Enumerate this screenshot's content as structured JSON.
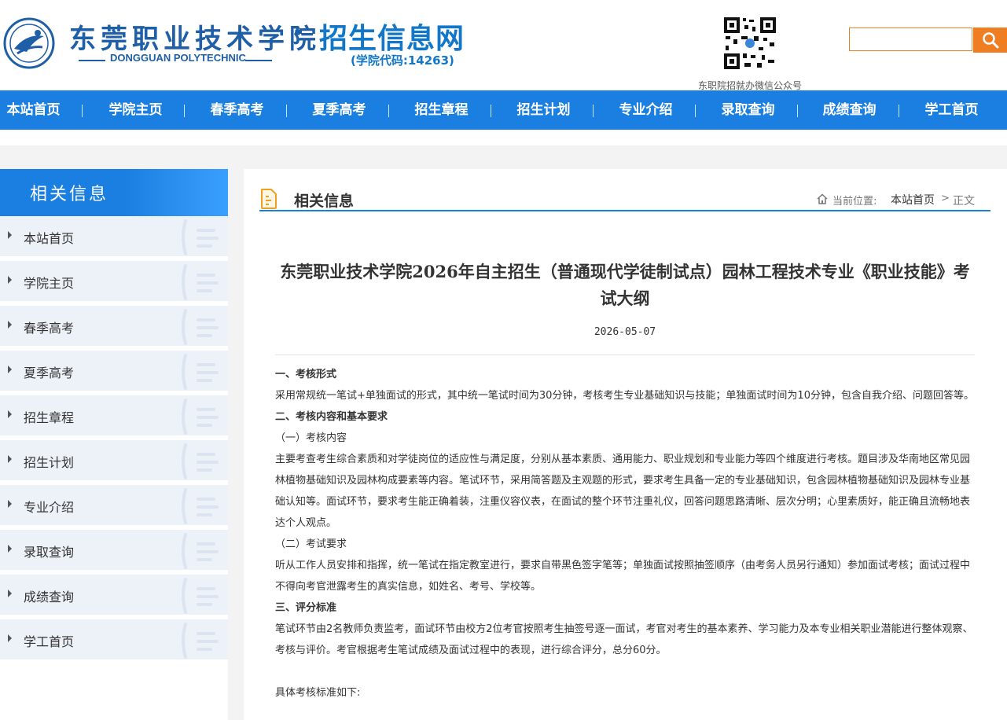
{
  "header": {
    "school_name_cn": "东莞职业技术学院",
    "school_name_en": "DONGGUAN POLYTECHNIC",
    "dot": "·",
    "site_title": "招生信息网",
    "school_code": "(学院代码:14263)",
    "qr_caption": "东职院招就办微信公众号",
    "search": {
      "value": "",
      "placeholder": ""
    }
  },
  "nav": {
    "items": [
      "本站首页",
      "学院主页",
      "春季高考",
      "夏季高考",
      "招生章程",
      "招生计划",
      "专业介绍",
      "录取查询",
      "成绩查询",
      "学工首页"
    ]
  },
  "sidebar": {
    "title": "相关信息",
    "items": [
      "本站首页",
      "学院主页",
      "春季高考",
      "夏季高考",
      "招生章程",
      "招生计划",
      "专业介绍",
      "录取查询",
      "成绩查询",
      "学工首页"
    ]
  },
  "main": {
    "section_title": "相关信息",
    "breadcrumb": {
      "prefix": "当前位置:",
      "home": "本站首页",
      "sep": ">",
      "current": "正文"
    }
  },
  "article": {
    "title": "东莞职业技术学院2026年自主招生（普通现代学徒制试点）园林工程技术专业《职业技能》考试大纲",
    "date": "2026-05-07",
    "paragraphs": [
      {
        "text": "一、考核形式",
        "bold": true
      },
      {
        "text": "采用常规统一笔试+单独面试的形式，其中统一笔试时间为30分钟，考核考生专业基础知识与技能；单独面试时间为10分钟，包含自我介绍、问题回答等。",
        "bold": false
      },
      {
        "text": "二、考核内容和基本要求",
        "bold": true
      },
      {
        "text": "（一）考核内容",
        "bold": false
      },
      {
        "text": "主要考查考生综合素质和对学徒岗位的适应性与满足度，分别从基本素质、通用能力、职业规划和专业能力等四个维度进行考核。题目涉及华南地区常见园林植物基础知识及园林构成要素等内容。笔试环节，采用简答题及主观题的形式，要求考生具备一定的专业基础知识，包含园林植物基础知识及园林专业基础认知等。面试环节，要求考生能正确着装，注重仪容仪表，在面试的整个环节注重礼仪，回答问题思路清晰、层次分明；心里素质好，能正确且流畅地表达个人观点。",
        "bold": false
      },
      {
        "text": "（二）考试要求",
        "bold": false
      },
      {
        "text": "听从工作人员安排和指挥，统一笔试在指定教室进行，要求自带黑色签字笔等；单独面试按照抽签顺序（由考务人员另行通知）参加面试考核；面试过程中不得向考官泄露考生的真实信息，如姓名、考号、学校等。",
        "bold": false
      },
      {
        "text": "三、评分标准",
        "bold": true
      },
      {
        "text": "笔试环节由2名教师负责监考，面试环节由校方2位考官按照考生抽签号逐一面试，考官对考生的基本素养、学习能力及本专业相关职业潜能进行整体观察、考核与评价。考官根据考生笔试成绩及面试过程中的表现，进行综合评分，总分60分。",
        "bold": false
      },
      {
        "text": "",
        "bold": false
      },
      {
        "text": "具体考核标准如下:",
        "bold": false
      }
    ]
  },
  "colors": {
    "primary": "#1a7fe0",
    "accent": "#ef7d22",
    "sidebar_item_bg": "#edf2f9"
  },
  "icons": [
    "school-emblem-icon",
    "qr-code-icon",
    "search-icon",
    "arrow-right-icon",
    "document-icon",
    "home-icon"
  ]
}
